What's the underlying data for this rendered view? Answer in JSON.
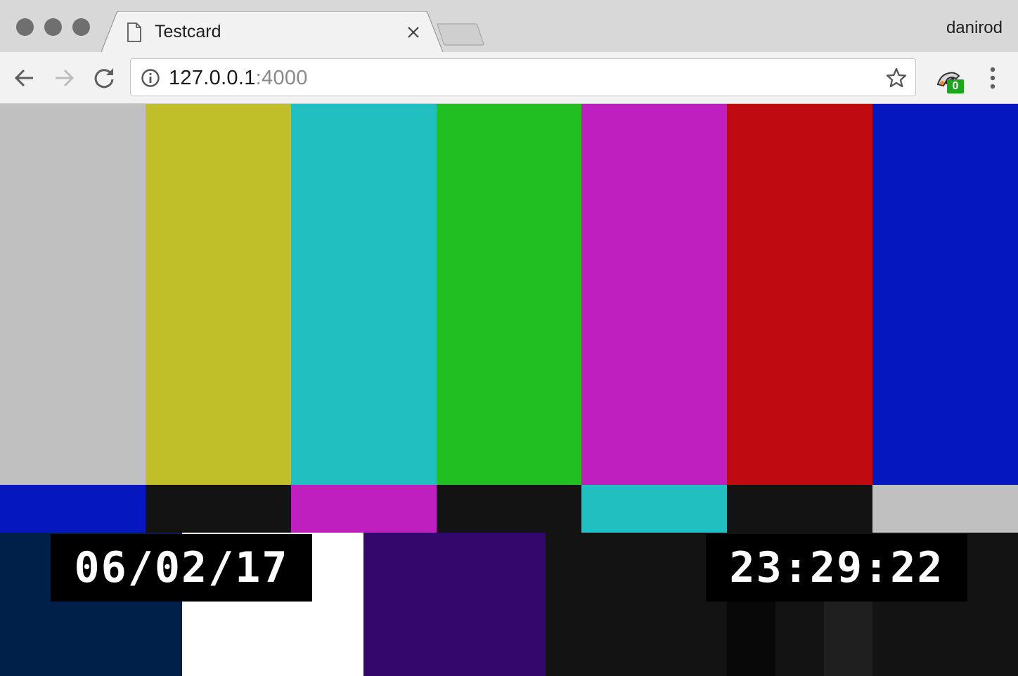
{
  "window": {
    "tab_title": "Testcard",
    "profile_name": "danirod"
  },
  "omnibox": {
    "url_host": "127.0.0.1",
    "url_port": ":4000"
  },
  "extension": {
    "badge_count": "0"
  },
  "testcard": {
    "date": "06/02/17",
    "time": "23:29:22",
    "colors": {
      "top_bars": [
        "#c0c0c0",
        "#c0bf2a",
        "#21bfbf",
        "#21bf21",
        "#bf1fbf",
        "#be0a10",
        "#0517bf"
      ],
      "middle_bars": [
        "#0517bf",
        "#131313",
        "#bf1fbf",
        "#131313",
        "#21bfbf",
        "#131313",
        "#c0c0c0"
      ],
      "bottom_blocks": [
        "#00204a",
        "#ffffff",
        "#34076c",
        "#131313"
      ],
      "pluge": [
        "#080808",
        "#131313",
        "#1f1f1f"
      ]
    }
  }
}
